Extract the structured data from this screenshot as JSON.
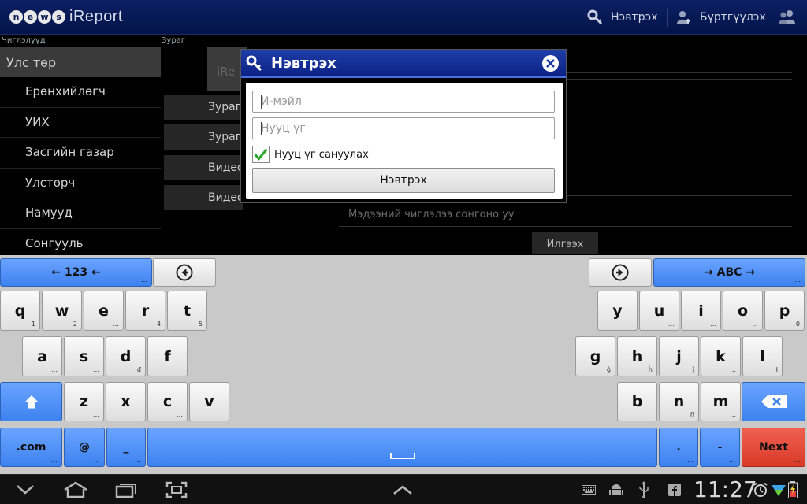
{
  "topbar": {
    "logo_news_letters": [
      "n",
      "e",
      "w",
      "s"
    ],
    "logo_text": "iReport",
    "login_label": "Нэвтрэх",
    "register_label": "Бүртгүүлэх"
  },
  "page": {
    "categories_label": "Чиглэлүүд",
    "image_label": "Зураг",
    "category_head": "Улс төр",
    "categories": [
      "Ерөнхийлөгч",
      "УИХ",
      "Засгийн газар",
      "Улстөрч",
      "Намууд",
      "Сонгууль"
    ],
    "media_buttons": [
      "Зураг",
      "Зураг",
      "Видео",
      "Видео"
    ],
    "thumb_text": "iRe",
    "culture_placeholder": "Мэдээний чиглэлээ сонгоно уу",
    "send_label": "Илгээх"
  },
  "dialog": {
    "title": "Нэвтрэх",
    "email_placeholder": "И-мэйл",
    "password_placeholder": "Нууц үг",
    "remember_label": "Нууц үг сануулах",
    "remember_checked": true,
    "submit_label": "Нэвтрэх"
  },
  "keyboard": {
    "mode_left": "← 123 ←",
    "mode_right": "→ ABC →",
    "row1_left": [
      [
        "q",
        "1"
      ],
      [
        "w",
        "2"
      ],
      [
        "e",
        "…"
      ],
      [
        "r",
        "4"
      ],
      [
        "t",
        "5"
      ]
    ],
    "row1_right": [
      [
        "y",
        ""
      ],
      [
        "u",
        "…"
      ],
      [
        "i",
        "…"
      ],
      [
        "o",
        "…"
      ],
      [
        "p",
        "0"
      ]
    ],
    "row2_left": [
      [
        "a",
        "…"
      ],
      [
        "s",
        "…"
      ],
      [
        "d",
        "đ"
      ],
      [
        "f",
        ""
      ]
    ],
    "row2_right": [
      [
        "g",
        "ĝ"
      ],
      [
        "h",
        "ĥ"
      ],
      [
        "j",
        "ĵ"
      ],
      [
        "k",
        "…"
      ],
      [
        "l",
        "ł"
      ]
    ],
    "row3_left": [
      [
        "z",
        "…"
      ],
      [
        "x",
        ""
      ],
      [
        "c",
        "…"
      ],
      [
        "v",
        ""
      ]
    ],
    "row3_right": [
      [
        "b",
        ""
      ],
      [
        "n",
        "ñ"
      ],
      [
        "m",
        "…"
      ]
    ],
    "com_label": ".com",
    "at_label": "@",
    "underscore_label": "_",
    "dot_label": ".",
    "dash_label": "-",
    "next_label": "Next",
    "colors": {
      "blue": "#4a8ef5",
      "red": "#e04a38"
    }
  },
  "navbar": {
    "clock": "11:27"
  }
}
